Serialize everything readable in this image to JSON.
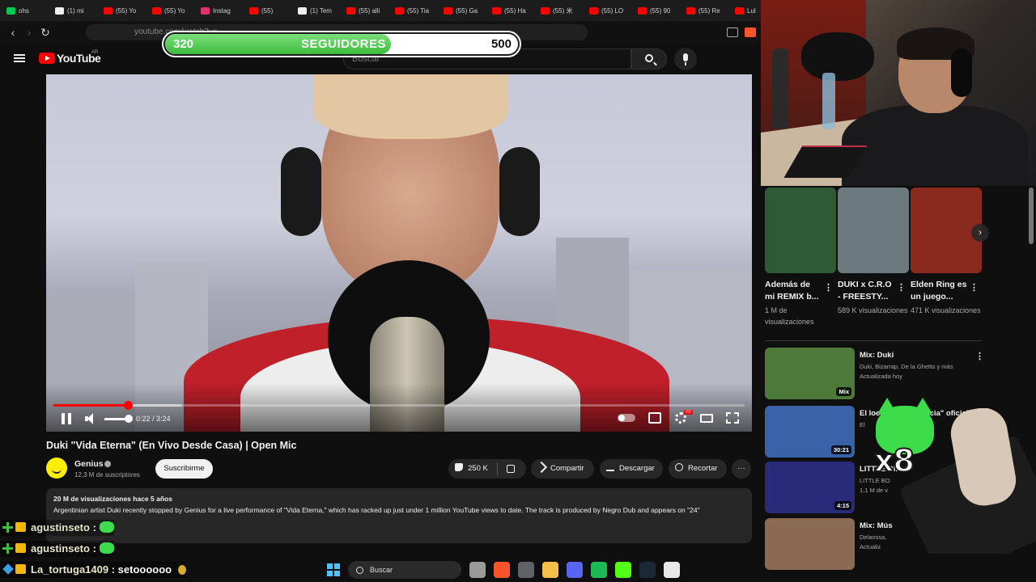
{
  "browser": {
    "tabs": [
      {
        "label": "ohs",
        "color": "#00c853"
      },
      {
        "label": "(1) mi",
        "color": "#eeeeee"
      },
      {
        "label": "(55) Yo",
        "color": "#ff0000"
      },
      {
        "label": "(55) Yo",
        "color": "#ff0000"
      },
      {
        "label": "Instag",
        "color": "#e1306c"
      },
      {
        "label": "(55)",
        "color": "#ff0000"
      },
      {
        "label": "(1) Tem",
        "color": "#eeeeee"
      },
      {
        "label": "(55) alli",
        "color": "#ff0000"
      },
      {
        "label": "(55) Tia",
        "color": "#ff0000"
      },
      {
        "label": "(55) Ga",
        "color": "#ff0000"
      },
      {
        "label": "(55) Ha",
        "color": "#ff0000"
      },
      {
        "label": "(55) 米",
        "color": "#ff0000"
      },
      {
        "label": "(55) LO",
        "color": "#ff0000"
      },
      {
        "label": "(55) 90",
        "color": "#ff0000"
      },
      {
        "label": "(55) Re",
        "color": "#ff0000"
      },
      {
        "label": "Lul",
        "color": "#ff0000"
      }
    ],
    "url": "youtube.com/watch?v=..."
  },
  "goal": {
    "current": "320",
    "label": "SEGUIDORES",
    "target": "500",
    "progress": 0.64
  },
  "youtube": {
    "logo": "YouTube",
    "country": "AR",
    "search_placeholder": "Buscar"
  },
  "player": {
    "time": "0:22 / 3:24",
    "played_fraction": 0.108,
    "buffered_fraction": 0.185,
    "volume_fraction": 1.0
  },
  "video": {
    "title": "Duki \"Vida Eterna\" (En Vivo Desde Casa) | Open Mic",
    "channel": "Genius",
    "subscribers": "12,3 M de suscriptores",
    "subscribe_label": "Suscribirme",
    "likes": "250 K",
    "share_label": "Compartir",
    "download_label": "Descargar",
    "clip_label": "Recortar",
    "more_label": "···",
    "views_age": "20 M de visualizaciones  hace 5 años",
    "description": "Argentinian artist Duki recently stopped by Genius for a live performance of \"Vida Eterna,\" which has racked up just under 1 million YouTube views to date. The track is produced by Negro Dub and appears on \"24\""
  },
  "shorts": [
    {
      "title": "Además de mi REMIX b...",
      "views": "1 M de visualizaciones",
      "bg": "#2f5a36"
    },
    {
      "title": "DUKI x C.R.O - FREESTY...",
      "views": "589 K visualizaciones",
      "bg": "#6c7a80"
    },
    {
      "title": "Elden Ring es un juego...",
      "views": "471 K visualizaciones",
      "bg": "#8a2a1e"
    }
  ],
  "mixes": [
    {
      "title": "Mix: Duki",
      "sub": "Duki, Bizarrap, De la Ghetto y más",
      "sub2": "Actualizada hoy",
      "badge": "Mix",
      "bg": "#4d7a3a"
    },
    {
      "title": "El loco ... La Farmacia\" oficial",
      "sub": "El",
      "sub2": "",
      "badge": "30:21",
      "bg": "#3a62a8"
    },
    {
      "title": "LITTLE BILLE",
      "sub": "LITTLE BO",
      "sub2": "1,1 M de v",
      "badge": "4:15",
      "bg": "#2a2a7a"
    },
    {
      "title": "Mix: Mús",
      "sub": "Delaossa,",
      "sub2": "Actualiz",
      "badge": "",
      "bg": "#8a6a52"
    }
  ],
  "emote_overlay": {
    "count": "x8"
  },
  "chat": [
    {
      "user": "agustinseto",
      "message": ":",
      "emote": "cat-emote",
      "badges": [
        "plus",
        "crown"
      ]
    },
    {
      "user": "agustinseto",
      "message": ":",
      "emote": "cat-emote",
      "badges": [
        "plus",
        "crown"
      ]
    },
    {
      "user": "La_tortuga1409",
      "message": ": setoooooo",
      "emote": "gold-emote",
      "badges": [
        "cube",
        "crown"
      ]
    }
  ],
  "taskbar": {
    "search_label": "Buscar",
    "apps": [
      {
        "name": "file-explorer-multitask",
        "color": "#9a9a9a"
      },
      {
        "name": "brave",
        "color": "#fb542b"
      },
      {
        "name": "chrome-like",
        "color": "#5f6368"
      },
      {
        "name": "folder",
        "color": "#f5c04a"
      },
      {
        "name": "discord",
        "color": "#5865f2"
      },
      {
        "name": "spotify",
        "color": "#1db954"
      },
      {
        "name": "kick",
        "color": "#53fc18"
      },
      {
        "name": "steam",
        "color": "#1b2838"
      },
      {
        "name": "calendar",
        "color": "#e8e8e8"
      }
    ]
  }
}
